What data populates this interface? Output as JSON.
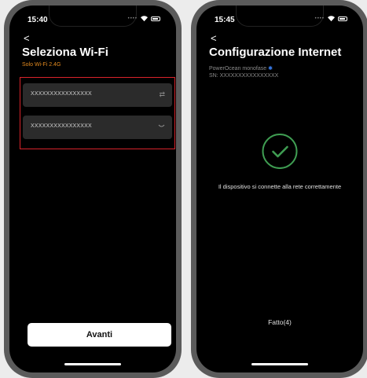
{
  "left": {
    "time": "15:40",
    "back": "<",
    "title": "Seleziona Wi-Fi",
    "subtitle": "Solo Wi-Fi 2.4G",
    "ssid_value": "XXXXXXXXXXXXXXXX",
    "password_value": "XXXXXXXXXXXXXXXX",
    "next_label": "Avanti"
  },
  "right": {
    "time": "15:45",
    "back": "<",
    "title": "Configurazione Internet",
    "device": "PowerOcean monofase",
    "sn": "SN: XXXXXXXXXXXXXXXX",
    "message": "Il dispositivo si connette alla rete correttamente",
    "done_label": "Fatto(4)"
  },
  "colors": {
    "accent_orange": "#e38a1f",
    "highlight_red": "#d8232a",
    "success_green": "#3f9d52",
    "bluetooth_blue": "#3b82f6"
  },
  "icons": [
    "chevron-left-icon",
    "wifi-icon",
    "battery-icon",
    "swap-icon",
    "eye-closed-icon",
    "bluetooth-icon",
    "check-icon"
  ]
}
